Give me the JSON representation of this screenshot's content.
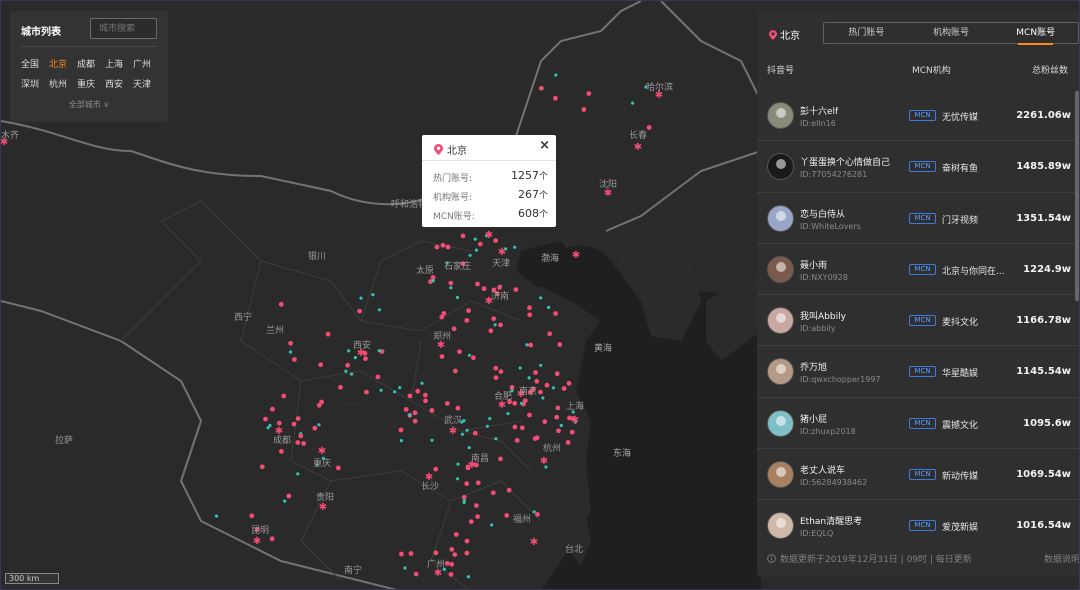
{
  "map": {
    "labels": [
      {
        "text": "哈尔滨",
        "kind": "city"
      },
      {
        "text": "长春",
        "kind": "city"
      },
      {
        "text": "沈阳",
        "kind": "city"
      },
      {
        "text": "呼和浩特",
        "kind": "city"
      },
      {
        "text": "银川",
        "kind": "city"
      },
      {
        "text": "太原",
        "kind": "city"
      },
      {
        "text": "石家庄",
        "kind": "city"
      },
      {
        "text": "天津",
        "kind": "city"
      },
      {
        "text": "渤海",
        "kind": "sea"
      },
      {
        "text": "济南",
        "kind": "city"
      },
      {
        "text": "西宁",
        "kind": "city"
      },
      {
        "text": "兰州",
        "kind": "city"
      },
      {
        "text": "郑州",
        "kind": "city"
      },
      {
        "text": "西安",
        "kind": "city"
      },
      {
        "text": "黄海",
        "kind": "sea"
      },
      {
        "text": "南京",
        "kind": "city"
      },
      {
        "text": "合肥",
        "kind": "city"
      },
      {
        "text": "上海",
        "kind": "city"
      },
      {
        "text": "武汉",
        "kind": "city"
      },
      {
        "text": "拉萨",
        "kind": "city"
      },
      {
        "text": "成都",
        "kind": "city"
      },
      {
        "text": "重庆",
        "kind": "city"
      },
      {
        "text": "杭州",
        "kind": "city"
      },
      {
        "text": "东海",
        "kind": "sea"
      },
      {
        "text": "南昌",
        "kind": "city"
      },
      {
        "text": "长沙",
        "kind": "city"
      },
      {
        "text": "贵阳",
        "kind": "city"
      },
      {
        "text": "福州",
        "kind": "city"
      },
      {
        "text": "昆明",
        "kind": "city"
      },
      {
        "text": "台北",
        "kind": "city"
      },
      {
        "text": "广州",
        "kind": "city"
      },
      {
        "text": "南宁",
        "kind": "city"
      },
      {
        "text": "木齐",
        "kind": "city"
      }
    ],
    "scale_label": "300 km",
    "colors": {
      "marker_pink": "#f24d73",
      "marker_teal": "#2ec4b6",
      "land": "#2b2b2b",
      "border": "#6b6b6b",
      "accent": "#ff8a1a"
    }
  },
  "city_panel": {
    "title": "城市列表",
    "search_placeholder": "城市搜索",
    "cities": [
      "全国",
      "北京",
      "成都",
      "上海",
      "广州",
      "深圳",
      "杭州",
      "重庆",
      "西安",
      "天津"
    ],
    "active_city": "北京",
    "all_cities_label": "全部城市",
    "all_cities_icon": "chevron-down-icon"
  },
  "popup": {
    "title": "北京",
    "icon": "map-pin-icon",
    "close_label": "×",
    "rows": [
      {
        "label": "热门账号:",
        "value": "1257",
        "unit": "个"
      },
      {
        "label": "机构账号:",
        "value": "267",
        "unit": "个"
      },
      {
        "label": "MCN账号:",
        "value": "608",
        "unit": "个"
      }
    ]
  },
  "panel": {
    "location": "北京",
    "tabs": [
      "热门账号",
      "机构账号",
      "MCN账号"
    ],
    "active_tab": "MCN账号",
    "columns": [
      "抖音号",
      "MCN机构",
      "总粉丝数"
    ],
    "rows": [
      {
        "name": "彭十六elf",
        "id": "ID:elln16",
        "badge": "MCN",
        "org": "无忧传媒",
        "fans": "2261.06w",
        "avatar_color": "#8a8a7a"
      },
      {
        "name": "丫蛋蛋换个心情做自己",
        "id": "ID:77054276281",
        "badge": "MCN",
        "org": "奋树有鱼",
        "fans": "1485.89w",
        "avatar_color": "#1a1a1a"
      },
      {
        "name": "恋与白侍从",
        "id": "ID:WhiteLovers",
        "badge": "MCN",
        "org": "门牙视频",
        "fans": "1351.54w",
        "avatar_color": "#9aa6c8"
      },
      {
        "name": "聂小雨",
        "id": "ID:NXY0928",
        "badge": "MCN",
        "org": "北京与你同在...",
        "fans": "1224.9w",
        "avatar_color": "#7a5a4a"
      },
      {
        "name": "我叫Abbily",
        "id": "ID:abbily",
        "badge": "MCN",
        "org": "麦抖文化",
        "fans": "1166.78w",
        "avatar_color": "#c8a8a0"
      },
      {
        "name": "乔万旭",
        "id": "ID:qwxchopper1997",
        "badge": "MCN",
        "org": "华星酷娱",
        "fans": "1145.54w",
        "avatar_color": "#b49a86"
      },
      {
        "name": "猪小屁",
        "id": "ID:zhuxp2018",
        "badge": "MCN",
        "org": "震撼文化",
        "fans": "1095.6w",
        "avatar_color": "#7fc0c8"
      },
      {
        "name": "老丈人说车",
        "id": "ID:56284938462",
        "badge": "MCN",
        "org": "新动传媒",
        "fans": "1069.54w",
        "avatar_color": "#a88060"
      },
      {
        "name": "Ethan清醒思考",
        "id": "ID:EQLQ",
        "badge": "MCN",
        "org": "爱茂新娱",
        "fans": "1016.54w",
        "avatar_color": "#d0b8a8"
      }
    ],
    "footer": "数据更新于2019年12月31日 | 09时 | 每日更新",
    "footer_icon": "info-icon",
    "footer_right": "数据说明"
  }
}
